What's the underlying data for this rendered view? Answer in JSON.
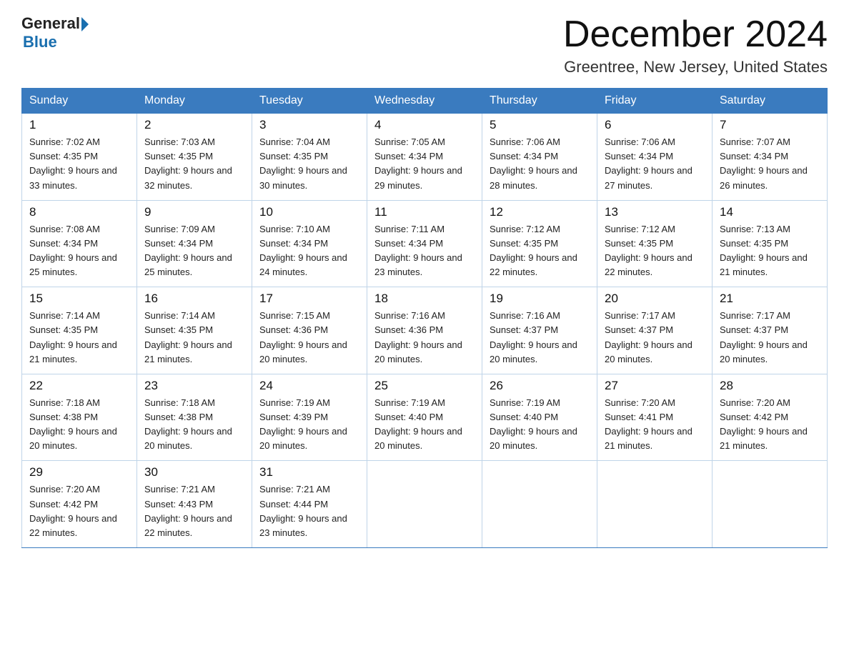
{
  "header": {
    "logo_general": "General",
    "logo_blue": "Blue",
    "month_title": "December 2024",
    "location": "Greentree, New Jersey, United States"
  },
  "days_of_week": [
    "Sunday",
    "Monday",
    "Tuesday",
    "Wednesday",
    "Thursday",
    "Friday",
    "Saturday"
  ],
  "weeks": [
    [
      {
        "day": "1",
        "sunrise": "7:02 AM",
        "sunset": "4:35 PM",
        "daylight": "9 hours and 33 minutes."
      },
      {
        "day": "2",
        "sunrise": "7:03 AM",
        "sunset": "4:35 PM",
        "daylight": "9 hours and 32 minutes."
      },
      {
        "day": "3",
        "sunrise": "7:04 AM",
        "sunset": "4:35 PM",
        "daylight": "9 hours and 30 minutes."
      },
      {
        "day": "4",
        "sunrise": "7:05 AM",
        "sunset": "4:34 PM",
        "daylight": "9 hours and 29 minutes."
      },
      {
        "day": "5",
        "sunrise": "7:06 AM",
        "sunset": "4:34 PM",
        "daylight": "9 hours and 28 minutes."
      },
      {
        "day": "6",
        "sunrise": "7:06 AM",
        "sunset": "4:34 PM",
        "daylight": "9 hours and 27 minutes."
      },
      {
        "day": "7",
        "sunrise": "7:07 AM",
        "sunset": "4:34 PM",
        "daylight": "9 hours and 26 minutes."
      }
    ],
    [
      {
        "day": "8",
        "sunrise": "7:08 AM",
        "sunset": "4:34 PM",
        "daylight": "9 hours and 25 minutes."
      },
      {
        "day": "9",
        "sunrise": "7:09 AM",
        "sunset": "4:34 PM",
        "daylight": "9 hours and 25 minutes."
      },
      {
        "day": "10",
        "sunrise": "7:10 AM",
        "sunset": "4:34 PM",
        "daylight": "9 hours and 24 minutes."
      },
      {
        "day": "11",
        "sunrise": "7:11 AM",
        "sunset": "4:34 PM",
        "daylight": "9 hours and 23 minutes."
      },
      {
        "day": "12",
        "sunrise": "7:12 AM",
        "sunset": "4:35 PM",
        "daylight": "9 hours and 22 minutes."
      },
      {
        "day": "13",
        "sunrise": "7:12 AM",
        "sunset": "4:35 PM",
        "daylight": "9 hours and 22 minutes."
      },
      {
        "day": "14",
        "sunrise": "7:13 AM",
        "sunset": "4:35 PM",
        "daylight": "9 hours and 21 minutes."
      }
    ],
    [
      {
        "day": "15",
        "sunrise": "7:14 AM",
        "sunset": "4:35 PM",
        "daylight": "9 hours and 21 minutes."
      },
      {
        "day": "16",
        "sunrise": "7:14 AM",
        "sunset": "4:35 PM",
        "daylight": "9 hours and 21 minutes."
      },
      {
        "day": "17",
        "sunrise": "7:15 AM",
        "sunset": "4:36 PM",
        "daylight": "9 hours and 20 minutes."
      },
      {
        "day": "18",
        "sunrise": "7:16 AM",
        "sunset": "4:36 PM",
        "daylight": "9 hours and 20 minutes."
      },
      {
        "day": "19",
        "sunrise": "7:16 AM",
        "sunset": "4:37 PM",
        "daylight": "9 hours and 20 minutes."
      },
      {
        "day": "20",
        "sunrise": "7:17 AM",
        "sunset": "4:37 PM",
        "daylight": "9 hours and 20 minutes."
      },
      {
        "day": "21",
        "sunrise": "7:17 AM",
        "sunset": "4:37 PM",
        "daylight": "9 hours and 20 minutes."
      }
    ],
    [
      {
        "day": "22",
        "sunrise": "7:18 AM",
        "sunset": "4:38 PM",
        "daylight": "9 hours and 20 minutes."
      },
      {
        "day": "23",
        "sunrise": "7:18 AM",
        "sunset": "4:38 PM",
        "daylight": "9 hours and 20 minutes."
      },
      {
        "day": "24",
        "sunrise": "7:19 AM",
        "sunset": "4:39 PM",
        "daylight": "9 hours and 20 minutes."
      },
      {
        "day": "25",
        "sunrise": "7:19 AM",
        "sunset": "4:40 PM",
        "daylight": "9 hours and 20 minutes."
      },
      {
        "day": "26",
        "sunrise": "7:19 AM",
        "sunset": "4:40 PM",
        "daylight": "9 hours and 20 minutes."
      },
      {
        "day": "27",
        "sunrise": "7:20 AM",
        "sunset": "4:41 PM",
        "daylight": "9 hours and 21 minutes."
      },
      {
        "day": "28",
        "sunrise": "7:20 AM",
        "sunset": "4:42 PM",
        "daylight": "9 hours and 21 minutes."
      }
    ],
    [
      {
        "day": "29",
        "sunrise": "7:20 AM",
        "sunset": "4:42 PM",
        "daylight": "9 hours and 22 minutes."
      },
      {
        "day": "30",
        "sunrise": "7:21 AM",
        "sunset": "4:43 PM",
        "daylight": "9 hours and 22 minutes."
      },
      {
        "day": "31",
        "sunrise": "7:21 AM",
        "sunset": "4:44 PM",
        "daylight": "9 hours and 23 minutes."
      },
      null,
      null,
      null,
      null
    ]
  ]
}
